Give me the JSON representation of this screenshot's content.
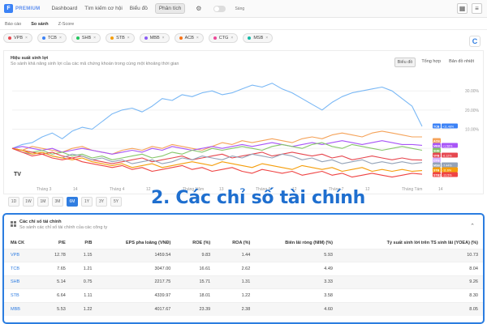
{
  "app": {
    "logo_letter": "F",
    "logo_text": "PREMIUM",
    "nav": [
      "Dashboard",
      "Tìm kiếm cơ hội",
      "Biểu đồ",
      "Phân tích"
    ],
    "nav_active": "Phân tích",
    "toggle_label": "Sáng"
  },
  "tabs": [
    "Báo cáo",
    "So sánh",
    "Z-Score"
  ],
  "tabs_active": "So sánh",
  "tickers": [
    {
      "code": "VPB",
      "color": "#e6474f"
    },
    {
      "code": "TCB",
      "color": "#3b82f6"
    },
    {
      "code": "SHB",
      "color": "#22c55e"
    },
    {
      "code": "STB",
      "color": "#f59e0b"
    },
    {
      "code": "MBB",
      "color": "#8b5cf6"
    },
    {
      "code": "ACB",
      "color": "#f97316"
    },
    {
      "code": "CTG",
      "color": "#ec4899"
    },
    {
      "code": "MSB",
      "color": "#14b8a6"
    }
  ],
  "chart_panel": {
    "title": "Hiệu suất sinh lợi",
    "subtitle": "So sánh khả năng sinh lợi của các mã chứng khoán trong cùng một khoảng thời gian",
    "view_tabs": [
      "Biểu đồ",
      "Tổng hợp",
      "Bản đồ nhiệt"
    ],
    "view_active": "Biểu đồ",
    "ranges": [
      "1D",
      "1W",
      "1M",
      "3M",
      "6M",
      "1Y",
      "3Y",
      "5Y"
    ],
    "range_active": "6M"
  },
  "chart_data": {
    "type": "line",
    "x_ticks": [
      "Tháng 3",
      "14",
      "Tháng 4",
      "12",
      "Tháng Năm",
      "13",
      "Tháng 6",
      "12",
      "Tháng 7",
      "12",
      "Tháng Tám",
      "14"
    ],
    "y_ticks": [
      "30.00%",
      "20.00%",
      "10.00%"
    ],
    "end_labels": [
      {
        "name": "TCB",
        "value": "+11.48%",
        "color": "#3b82f6"
      },
      {
        "name": "ACB",
        "value": "",
        "color": "#f5a35a"
      },
      {
        "name": "MBB",
        "value": "+1.58%",
        "color": "#a855f7"
      },
      {
        "name": "SHB",
        "value": "",
        "color": "#86c66a"
      },
      {
        "name": "VPB",
        "value": "-6.12%",
        "color": "#e6474f"
      },
      {
        "name": "CTG",
        "value": "",
        "color": "#d8b4fe"
      },
      {
        "name": "MSB",
        "value": "-7.44%",
        "color": "#94a3b8"
      },
      {
        "name": "STB",
        "value": "-11.6%",
        "color": "#f59e0b"
      },
      {
        "name": "STB2",
        "value": "-13.5%",
        "color": "#ef4444"
      }
    ],
    "series": [
      {
        "name": "TCB",
        "color": "#7ab8f5",
        "values": [
          0,
          2,
          3,
          6,
          8,
          5,
          9,
          11,
          10,
          14,
          18,
          20,
          21,
          19,
          22,
          26,
          25,
          28,
          27,
          29,
          30,
          28,
          29,
          31,
          33,
          32,
          34,
          31,
          29,
          26,
          23,
          20,
          24,
          27,
          29,
          30,
          31,
          32,
          30,
          26,
          22,
          11.5
        ]
      },
      {
        "name": "ACB",
        "color": "#f5a35a",
        "values": [
          0,
          -1,
          1,
          0,
          -1,
          -2,
          0,
          1,
          -1,
          -2,
          -3,
          -1,
          0,
          -1,
          1,
          0,
          2,
          1,
          0,
          -1,
          1,
          3,
          2,
          4,
          3,
          4,
          5,
          4,
          3,
          5,
          6,
          5,
          7,
          8,
          7,
          6,
          8,
          9,
          8,
          7,
          6,
          6
        ]
      },
      {
        "name": "MBB",
        "color": "#a855f7",
        "values": [
          0,
          1,
          0,
          -1,
          0,
          -2,
          -1,
          0,
          -1,
          -2,
          -3,
          -2,
          -1,
          -2,
          0,
          -1,
          1,
          0,
          -1,
          0,
          1,
          0,
          1,
          2,
          1,
          2,
          3,
          2,
          1,
          2,
          3,
          2,
          3,
          4,
          3,
          2,
          3,
          4,
          3,
          2,
          2,
          1.6
        ]
      },
      {
        "name": "SHB",
        "color": "#86c66a",
        "values": [
          0,
          -1,
          -2,
          -1,
          -3,
          -2,
          -4,
          -3,
          -5,
          -4,
          -6,
          -5,
          -4,
          -3,
          -5,
          -4,
          -2,
          -3,
          -1,
          -2,
          0,
          -1,
          0,
          1,
          0,
          -1,
          1,
          2,
          1,
          0,
          2,
          3,
          1,
          0,
          2,
          1,
          0,
          -1,
          0,
          1,
          0,
          -1
        ]
      },
      {
        "name": "VPB",
        "color": "#e6474f",
        "values": [
          0,
          -1,
          -2,
          -3,
          -2,
          -4,
          -5,
          -4,
          -6,
          -7,
          -8,
          -7,
          -6,
          -5,
          -7,
          -6,
          -5,
          -4,
          -6,
          -5,
          -4,
          -3,
          -5,
          -4,
          -3,
          -2,
          -4,
          -3,
          -2,
          -3,
          -4,
          -3,
          -5,
          -4,
          -6,
          -5,
          -4,
          -5,
          -6,
          -5,
          -6,
          -6.1
        ]
      },
      {
        "name": "MSB",
        "color": "#94a3b8",
        "values": [
          0,
          -2,
          -3,
          -2,
          -4,
          -5,
          -3,
          -4,
          -6,
          -5,
          -7,
          -6,
          -8,
          -7,
          -6,
          -8,
          -7,
          -5,
          -6,
          -4,
          -5,
          -6,
          -4,
          -5,
          -3,
          -4,
          -5,
          -3,
          -4,
          -6,
          -5,
          -7,
          -6,
          -8,
          -7,
          -6,
          -8,
          -7,
          -8,
          -7,
          -8,
          -7.4
        ]
      },
      {
        "name": "STB",
        "color": "#f59e0b",
        "values": [
          0,
          -1,
          -3,
          -2,
          -4,
          -5,
          -6,
          -5,
          -7,
          -8,
          -9,
          -8,
          -10,
          -9,
          -8,
          -10,
          -9,
          -8,
          -7,
          -8,
          -9,
          -7,
          -8,
          -9,
          -10,
          -8,
          -9,
          -10,
          -11,
          -9,
          -10,
          -11,
          -10,
          -12,
          -11,
          -10,
          -12,
          -11,
          -12,
          -11,
          -12,
          -11.6
        ]
      },
      {
        "name": "CTG",
        "color": "#ef4444",
        "values": [
          0,
          -2,
          -4,
          -3,
          -5,
          -6,
          -5,
          -7,
          -8,
          -9,
          -10,
          -9,
          -11,
          -10,
          -12,
          -11,
          -10,
          -9,
          -11,
          -10,
          -12,
          -11,
          -10,
          -12,
          -13,
          -11,
          -12,
          -13,
          -12,
          -14,
          -13,
          -12,
          -14,
          -13,
          -15,
          -14,
          -13,
          -14,
          -15,
          -14,
          -13,
          -13.5
        ]
      }
    ]
  },
  "section_heading": "2. Các chỉ số tài chính",
  "fin": {
    "title": "Các chỉ số tài chính",
    "subtitle": "So sánh các chỉ số tài chính của các công ty",
    "columns": [
      "Mã CK",
      "P/E",
      "P/B",
      "EPS pha loãng (VNĐ)",
      "ROE (%)",
      "ROA (%)",
      "Biên lãi ròng (NIM) (%)",
      "Tỷ suất sinh lời trên TS sinh lãi (YOEA) (%)"
    ],
    "rows": [
      [
        "VPB",
        "12.78",
        "1.15",
        "1459.54",
        "9.83",
        "1.44",
        "5.93",
        "10.73"
      ],
      [
        "TCB",
        "7.65",
        "1.21",
        "3047.00",
        "16.61",
        "2.62",
        "4.49",
        "8.04"
      ],
      [
        "SHB",
        "5.14",
        "0.75",
        "2217.75",
        "15.71",
        "1.31",
        "3.33",
        "9.26"
      ],
      [
        "STB",
        "6.64",
        "1.11",
        "4339.97",
        "18.01",
        "1.22",
        "3.58",
        "8.30"
      ],
      [
        "MBB",
        "5.53",
        "1.22",
        "4017.67",
        "23.39",
        "2.38",
        "4.60",
        "8.05"
      ]
    ]
  }
}
